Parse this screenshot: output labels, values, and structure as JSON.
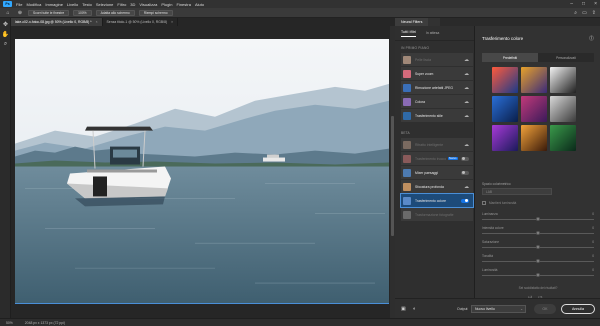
{
  "app": {
    "logo": "Ps"
  },
  "menu": [
    "File",
    "Modifica",
    "Immagine",
    "Livello",
    "Testo",
    "Selezione",
    "Filtro",
    "3D",
    "Visualizza",
    "Plugin",
    "Finestra",
    "Aiuto"
  ],
  "options_bar": {
    "select_subject": "Scorri tutte le finestre",
    "zoom": "100%",
    "fit_screen": "Adatta allo schermo",
    "fill_screen": "Riempi schermo"
  },
  "document": {
    "tabs": [
      {
        "label": "lake-c02-x-fotoc-08.jpg @ 50% (Livello 0, RGB/8) *",
        "active": true
      },
      {
        "label": "Senza titolo-1 @ 50% (Livello 0, RGB/8)",
        "active": false
      }
    ]
  },
  "status": {
    "zoom": "50%",
    "doc_size": "2048 px x 1373 px (72 ppi)"
  },
  "neural_filters": {
    "panel_tab": "Neural Filters",
    "subtabs": [
      "Tutti i filtri",
      "In attesa"
    ],
    "section_featured": "IN PRIMO PIANO",
    "featured": [
      {
        "label": "Pelle liscia",
        "dim": true,
        "color": "#a08878"
      },
      {
        "label": "Super zoom",
        "dim": false,
        "color": "#d46a7b"
      },
      {
        "label": "Rimozione artefatti JPEG",
        "dim": false,
        "color": "#3a6fb8"
      },
      {
        "label": "Colora",
        "dim": false,
        "color": "#8a6bb5"
      },
      {
        "label": "Trasferimento stile",
        "dim": false,
        "color": "#2f6aa8"
      }
    ],
    "section_beta": "BETA",
    "beta": [
      {
        "label": "Ritratto intelligente",
        "dim": true,
        "color": "#7a6a60",
        "state": "cloud"
      },
      {
        "label": "Trasferimento trucco",
        "dim": true,
        "color": "#8a5a5a",
        "state": "badge"
      },
      {
        "label": "Mixer paesaggi",
        "dim": false,
        "color": "#4d7ab0",
        "state": "toggle"
      },
      {
        "label": "Sfocatura profonda",
        "dim": false,
        "color": "#c09060",
        "state": "cloud"
      },
      {
        "label": "Trasferimento colore",
        "dim": false,
        "color": "#5a8ac8",
        "state": "toggle-on",
        "selected": true
      },
      {
        "label": "Trasformazione fotografie",
        "dim": true,
        "color": "#6a6a6a",
        "state": "none"
      }
    ],
    "beta_badge": "Nuovo",
    "settings": {
      "title": "Trasferimento colore",
      "mode_tabs": [
        "Predefiniti",
        "Personalizzati"
      ],
      "swatches": [
        {
          "c1": "#ff5a3c",
          "c2": "#1a3a8a"
        },
        {
          "c1": "#e8a22a",
          "c2": "#3a2a7a"
        },
        {
          "c1": "#f2f2f2",
          "c2": "#202020"
        },
        {
          "c1": "#2a6fd8",
          "c2": "#0a1e4a"
        },
        {
          "c1": "#c23a7a",
          "c2": "#3a1a5a"
        },
        {
          "c1": "#d8d8d8",
          "c2": "#3a3a3a"
        },
        {
          "c1": "#a83ad8",
          "c2": "#1a1a5a"
        },
        {
          "c1": "#f2a23a",
          "c2": "#3a1a0a"
        },
        {
          "c1": "#3a9a4a",
          "c2": "#0a2a1a"
        }
      ],
      "color_space_label": "Spazio colorimetrico",
      "color_space_value": "LAB",
      "preserve_luminosity": "Mantieni luminosità",
      "sliders": [
        {
          "label": "Luminanza",
          "value": "0",
          "frac": 0.5
        },
        {
          "label": "Intensità colore",
          "value": "0",
          "frac": 0.5
        },
        {
          "label": "Saturazione",
          "value": "0",
          "frac": 0.5
        },
        {
          "label": "Tonalità",
          "value": "0",
          "frac": 0.5
        },
        {
          "label": "Luminosità",
          "value": "0",
          "frac": 0.5
        }
      ],
      "feedback": "Sei soddisfatto dei risultati?"
    },
    "output_label": "Output",
    "output_value": "Nuovo livello",
    "ok": "OK",
    "cancel": "Annulla"
  }
}
